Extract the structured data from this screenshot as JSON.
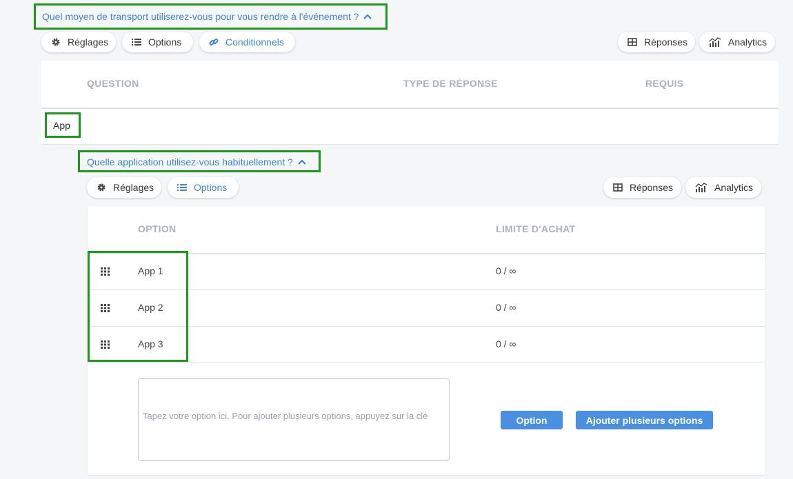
{
  "question": {
    "title": "Quel moyen de transport utiliserez-vous pour vous rendre à l'événement ?",
    "toolbar": {
      "settings_label": "Réglages",
      "options_label": "Options",
      "conditionals_label": "Conditionnels",
      "responses_label": "Réponses",
      "analytics_label": "Analytics"
    },
    "table": {
      "col_question": "QUESTION",
      "col_type": "TYPE DE RÉPONSE",
      "col_required": "REQUIS"
    },
    "option_row_label": "App"
  },
  "sub_question": {
    "title": "Quelle application utilisez-vous habituellement ?",
    "toolbar": {
      "settings_label": "Réglages",
      "options_label": "Options",
      "responses_label": "Réponses",
      "analytics_label": "Analytics"
    },
    "table": {
      "col_option": "OPTION",
      "col_limit": "LIMITE D'ACHAT",
      "rows": [
        {
          "label": "App 1",
          "limit": "0 / ∞"
        },
        {
          "label": "App 2",
          "limit": "0 / ∞"
        },
        {
          "label": "App 3",
          "limit": "0 / ∞"
        }
      ]
    },
    "input_placeholder": "Tapez votre option ici. Pour ajouter plusieurs options, appuyez sur la clé",
    "add_option_label": "Option",
    "add_multiple_label": "Ajouter plusieurs options"
  },
  "colors": {
    "accent": "#3d86d8",
    "button": "#4a90e2",
    "highlight": "#1b9a1b"
  },
  "icons": [
    "gear-icon",
    "list-icon",
    "link-icon",
    "table-icon",
    "analytics-icon",
    "chevron-up-icon",
    "drag-grid-icon"
  ]
}
